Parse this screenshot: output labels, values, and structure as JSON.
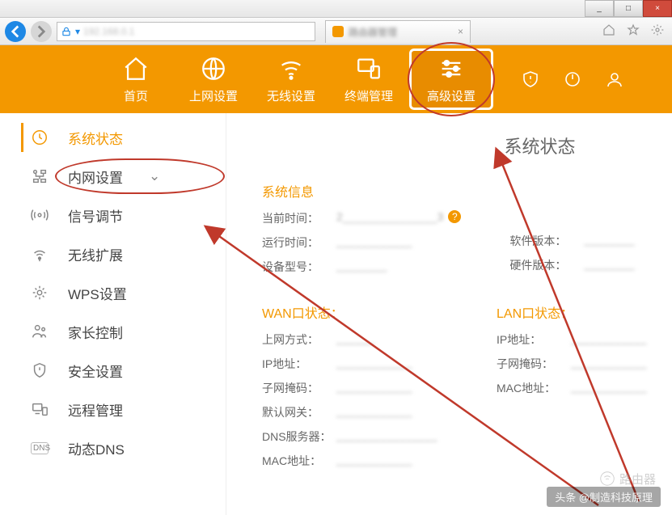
{
  "window_buttons": {
    "min": "_",
    "max": "□",
    "close": "×"
  },
  "browser": {
    "back": "←",
    "forward": "→",
    "url_icon": "🔒",
    "url_text": "192.168.0.1",
    "tab_text": "路由器管理",
    "tab_close": "×"
  },
  "topnav": {
    "items": [
      {
        "key": "home",
        "label": "首页"
      },
      {
        "key": "net",
        "label": "上网设置"
      },
      {
        "key": "wifi",
        "label": "无线设置"
      },
      {
        "key": "term",
        "label": "终端管理"
      },
      {
        "key": "adv",
        "label": "高级设置"
      }
    ]
  },
  "sidebar": {
    "items": [
      {
        "label": "系统状态",
        "icon": "clock",
        "active": true
      },
      {
        "label": "内网设置",
        "icon": "lan",
        "expandable": true
      },
      {
        "label": "信号调节",
        "icon": "signal"
      },
      {
        "label": "无线扩展",
        "icon": "extend"
      },
      {
        "label": "WPS设置",
        "icon": "wps"
      },
      {
        "label": "家长控制",
        "icon": "parent"
      },
      {
        "label": "安全设置",
        "icon": "shield"
      },
      {
        "label": "远程管理",
        "icon": "remote"
      },
      {
        "label": "动态DNS",
        "icon": "dns"
      }
    ]
  },
  "content": {
    "page_title": "系统状态",
    "sec_sysinfo": "系统信息",
    "sysinfo": {
      "time_lbl": "当前时间：",
      "time_val": "2_______________3",
      "uptime_lbl": "运行时间：",
      "uptime_val": "____________",
      "model_lbl": "设备型号：",
      "model_val": "________",
      "sw_lbl": "软件版本：",
      "sw_val": "________",
      "hw_lbl": "硬件版本：",
      "hw_val": "________"
    },
    "sec_wan": "WAN口状态：",
    "wan": {
      "mode_lbl": "上网方式：",
      "mode_val": "______",
      "ip_lbl": "IP地址：",
      "ip_val": "____________",
      "mask_lbl": "子网掩码：",
      "mask_val": "____________",
      "gw_lbl": "默认网关：",
      "gw_val": "____________",
      "dns_lbl": "DNS服务器：",
      "dns_val": "________________",
      "mac_lbl": "MAC地址：",
      "mac_val": "____________"
    },
    "sec_lan": "LAN口状态：",
    "lan": {
      "ip_lbl": "IP地址：",
      "ip_val": "____________",
      "mask_lbl": "子网掩码：",
      "mask_val": "____________",
      "mac_lbl": "MAC地址：",
      "mac_val": "____________"
    }
  },
  "watermark": "头条 @制造科技原理",
  "wmlogo": "路由器"
}
